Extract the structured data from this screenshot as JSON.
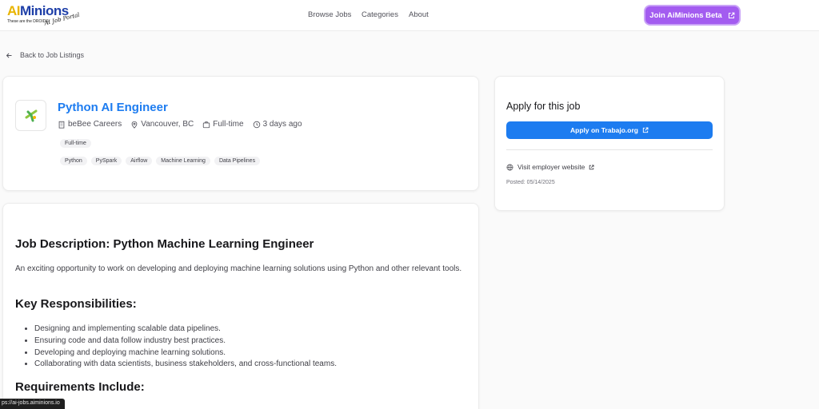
{
  "header": {
    "logo": {
      "ai": "AI",
      "rest": "Minions",
      "tagline": "These are the DROIDS",
      "script": "AI Job Portal"
    },
    "nav": [
      "Browse Jobs",
      "Categories",
      "About"
    ],
    "join_label": "Join AiMinions Beta"
  },
  "back_label": "Back to Job Listings",
  "job": {
    "title": "Python AI Engineer",
    "company": "beBee Careers",
    "location": "Vancouver, BC",
    "type": "Full-time",
    "posted_ago": "3 days ago",
    "type_chip": "Full-time",
    "skills": [
      "Python",
      "PySpark",
      "Airflow",
      "Machine Learning",
      "Data Pipelines"
    ]
  },
  "description": {
    "heading": "Job Description: Python Machine Learning Engineer",
    "intro": "An exciting opportunity to work on developing and deploying machine learning solutions using Python and other relevant tools.",
    "responsibilities_heading": "Key Responsibilities:",
    "responsibilities": [
      "Designing and implementing scalable data pipelines.",
      "Ensuring code and data follow industry best practices.",
      "Developing and deploying machine learning solutions.",
      "Collaborating with data scientists, business stakeholders, and cross-functional teams."
    ],
    "requirements_heading": "Requirements Include:"
  },
  "apply": {
    "title": "Apply for this job",
    "button_label": "Apply on Trabajo.org",
    "visit_label": "Visit employer website",
    "posted": "Posted: 05/14/2025"
  },
  "status_url": "ps://ai-jobs.aiminions.io",
  "colors": {
    "accent_blue": "#1d7cf0",
    "beta_purple": "#a35cf0"
  }
}
